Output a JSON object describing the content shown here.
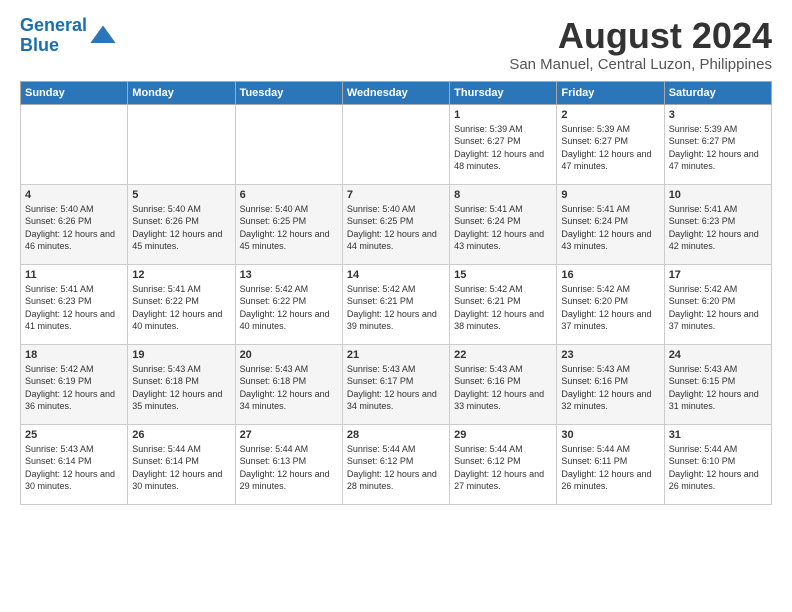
{
  "logo": {
    "line1": "General",
    "line2": "Blue"
  },
  "title": "August 2024",
  "subtitle": "San Manuel, Central Luzon, Philippines",
  "colors": {
    "header_bg": "#2a76b8"
  },
  "days_of_week": [
    "Sunday",
    "Monday",
    "Tuesday",
    "Wednesday",
    "Thursday",
    "Friday",
    "Saturday"
  ],
  "weeks": [
    [
      {
        "day": "",
        "text": ""
      },
      {
        "day": "",
        "text": ""
      },
      {
        "day": "",
        "text": ""
      },
      {
        "day": "",
        "text": ""
      },
      {
        "day": "1",
        "text": "Sunrise: 5:39 AM\nSunset: 6:27 PM\nDaylight: 12 hours and 48 minutes."
      },
      {
        "day": "2",
        "text": "Sunrise: 5:39 AM\nSunset: 6:27 PM\nDaylight: 12 hours and 47 minutes."
      },
      {
        "day": "3",
        "text": "Sunrise: 5:39 AM\nSunset: 6:27 PM\nDaylight: 12 hours and 47 minutes."
      }
    ],
    [
      {
        "day": "4",
        "text": "Sunrise: 5:40 AM\nSunset: 6:26 PM\nDaylight: 12 hours and 46 minutes."
      },
      {
        "day": "5",
        "text": "Sunrise: 5:40 AM\nSunset: 6:26 PM\nDaylight: 12 hours and 45 minutes."
      },
      {
        "day": "6",
        "text": "Sunrise: 5:40 AM\nSunset: 6:25 PM\nDaylight: 12 hours and 45 minutes."
      },
      {
        "day": "7",
        "text": "Sunrise: 5:40 AM\nSunset: 6:25 PM\nDaylight: 12 hours and 44 minutes."
      },
      {
        "day": "8",
        "text": "Sunrise: 5:41 AM\nSunset: 6:24 PM\nDaylight: 12 hours and 43 minutes."
      },
      {
        "day": "9",
        "text": "Sunrise: 5:41 AM\nSunset: 6:24 PM\nDaylight: 12 hours and 43 minutes."
      },
      {
        "day": "10",
        "text": "Sunrise: 5:41 AM\nSunset: 6:23 PM\nDaylight: 12 hours and 42 minutes."
      }
    ],
    [
      {
        "day": "11",
        "text": "Sunrise: 5:41 AM\nSunset: 6:23 PM\nDaylight: 12 hours and 41 minutes."
      },
      {
        "day": "12",
        "text": "Sunrise: 5:41 AM\nSunset: 6:22 PM\nDaylight: 12 hours and 40 minutes."
      },
      {
        "day": "13",
        "text": "Sunrise: 5:42 AM\nSunset: 6:22 PM\nDaylight: 12 hours and 40 minutes."
      },
      {
        "day": "14",
        "text": "Sunrise: 5:42 AM\nSunset: 6:21 PM\nDaylight: 12 hours and 39 minutes."
      },
      {
        "day": "15",
        "text": "Sunrise: 5:42 AM\nSunset: 6:21 PM\nDaylight: 12 hours and 38 minutes."
      },
      {
        "day": "16",
        "text": "Sunrise: 5:42 AM\nSunset: 6:20 PM\nDaylight: 12 hours and 37 minutes."
      },
      {
        "day": "17",
        "text": "Sunrise: 5:42 AM\nSunset: 6:20 PM\nDaylight: 12 hours and 37 minutes."
      }
    ],
    [
      {
        "day": "18",
        "text": "Sunrise: 5:42 AM\nSunset: 6:19 PM\nDaylight: 12 hours and 36 minutes."
      },
      {
        "day": "19",
        "text": "Sunrise: 5:43 AM\nSunset: 6:18 PM\nDaylight: 12 hours and 35 minutes."
      },
      {
        "day": "20",
        "text": "Sunrise: 5:43 AM\nSunset: 6:18 PM\nDaylight: 12 hours and 34 minutes."
      },
      {
        "day": "21",
        "text": "Sunrise: 5:43 AM\nSunset: 6:17 PM\nDaylight: 12 hours and 34 minutes."
      },
      {
        "day": "22",
        "text": "Sunrise: 5:43 AM\nSunset: 6:16 PM\nDaylight: 12 hours and 33 minutes."
      },
      {
        "day": "23",
        "text": "Sunrise: 5:43 AM\nSunset: 6:16 PM\nDaylight: 12 hours and 32 minutes."
      },
      {
        "day": "24",
        "text": "Sunrise: 5:43 AM\nSunset: 6:15 PM\nDaylight: 12 hours and 31 minutes."
      }
    ],
    [
      {
        "day": "25",
        "text": "Sunrise: 5:43 AM\nSunset: 6:14 PM\nDaylight: 12 hours and 30 minutes."
      },
      {
        "day": "26",
        "text": "Sunrise: 5:44 AM\nSunset: 6:14 PM\nDaylight: 12 hours and 30 minutes."
      },
      {
        "day": "27",
        "text": "Sunrise: 5:44 AM\nSunset: 6:13 PM\nDaylight: 12 hours and 29 minutes."
      },
      {
        "day": "28",
        "text": "Sunrise: 5:44 AM\nSunset: 6:12 PM\nDaylight: 12 hours and 28 minutes."
      },
      {
        "day": "29",
        "text": "Sunrise: 5:44 AM\nSunset: 6:12 PM\nDaylight: 12 hours and 27 minutes."
      },
      {
        "day": "30",
        "text": "Sunrise: 5:44 AM\nSunset: 6:11 PM\nDaylight: 12 hours and 26 minutes."
      },
      {
        "day": "31",
        "text": "Sunrise: 5:44 AM\nSunset: 6:10 PM\nDaylight: 12 hours and 26 minutes."
      }
    ]
  ]
}
